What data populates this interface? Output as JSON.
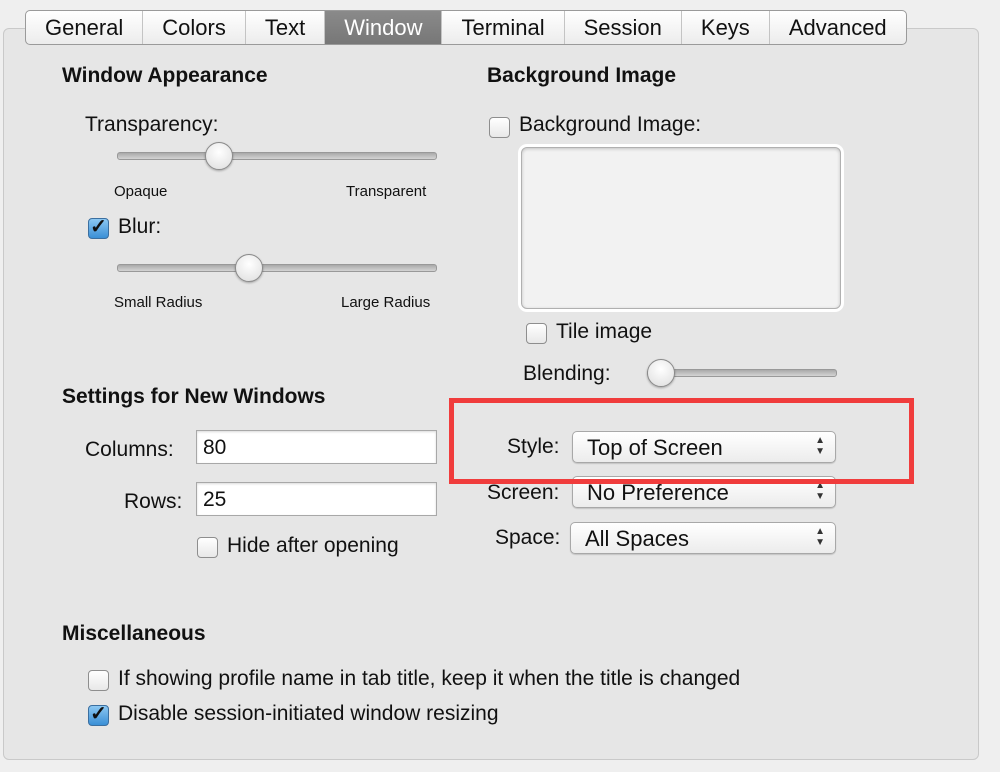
{
  "tabs": [
    {
      "label": "General"
    },
    {
      "label": "Colors"
    },
    {
      "label": "Text"
    },
    {
      "label": "Window",
      "selected": true
    },
    {
      "label": "Terminal"
    },
    {
      "label": "Session"
    },
    {
      "label": "Keys"
    },
    {
      "label": "Advanced"
    }
  ],
  "appearance": {
    "heading": "Window Appearance",
    "transparency_label": "Transparency:",
    "transparency_value": 0.3,
    "opaque": "Opaque",
    "transparent": "Transparent",
    "blur_label": "Blur:",
    "blur_checked": true,
    "blur_value": 0.4,
    "small_radius": "Small Radius",
    "large_radius": "Large Radius"
  },
  "background": {
    "heading": "Background Image",
    "checkbox_label": "Background Image:",
    "checked": false,
    "tile_label": "Tile image",
    "tile_checked": false,
    "blending_label": "Blending:",
    "blending_value": 0.0
  },
  "new_windows": {
    "heading": "Settings for New Windows",
    "columns_label": "Columns:",
    "columns_value": "80",
    "rows_label": "Rows:",
    "rows_value": "25",
    "hide_label": "Hide after opening",
    "hide_checked": false
  },
  "placement": {
    "style_label": "Style:",
    "style_value": "Top of Screen",
    "screen_label": "Screen:",
    "screen_value": "No Preference",
    "space_label": "Space:",
    "space_value": "All Spaces"
  },
  "misc": {
    "heading": "Miscellaneous",
    "option1": "If showing profile name in tab title, keep it when the title is changed",
    "option1_checked": false,
    "option2": "Disable session-initiated window resizing",
    "option2_checked": true
  },
  "colors": {
    "highlight": "#f03c3c",
    "selected_tab": "#808080"
  }
}
